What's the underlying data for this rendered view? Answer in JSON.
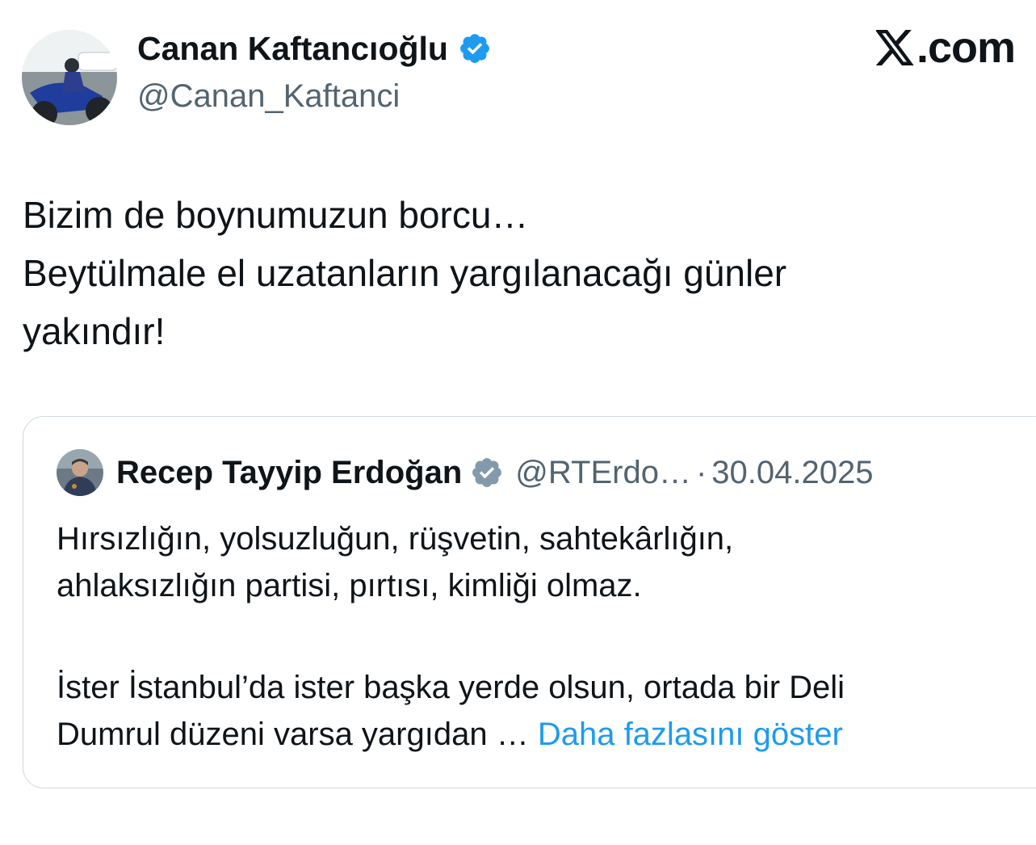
{
  "author": {
    "display_name": "Canan Kaftancıoğlu",
    "handle": "@Canan_Kaftanci",
    "verified_icon": "verified-badge-blue"
  },
  "brand": {
    "text": ".com",
    "logo": "x-logo"
  },
  "tweet": {
    "lines": [
      "Bizim de boynumuzun borcu…",
      "Beytülmale el uzatanların yargılanacağı günler",
      "yakındır!"
    ]
  },
  "quote": {
    "display_name": "Recep Tayyip Erdoğan",
    "verified_icon": "verified-badge-gray",
    "handle": "@RTErdo…",
    "separator": "·",
    "date": "30.04.2025",
    "paragraph1": [
      "Hırsızlığın, yolsuzluğun, rüşvetin, sahtekârlığın,",
      "ahlaksızlığın partisi, pırtısı, kimliği olmaz."
    ],
    "paragraph2": [
      "İster İstanbul’da ister başka yerde olsun, ortada bir Deli",
      "Dumrul düzeni varsa yargıdan … "
    ],
    "show_more": "Daha fazlasını göster"
  },
  "colors": {
    "text": "#0f1419",
    "secondary": "#536471",
    "link": "#1d9bf0",
    "verified_blue": "#1d9bf0",
    "verified_gray": "#829aab",
    "border": "#cfd9de"
  }
}
